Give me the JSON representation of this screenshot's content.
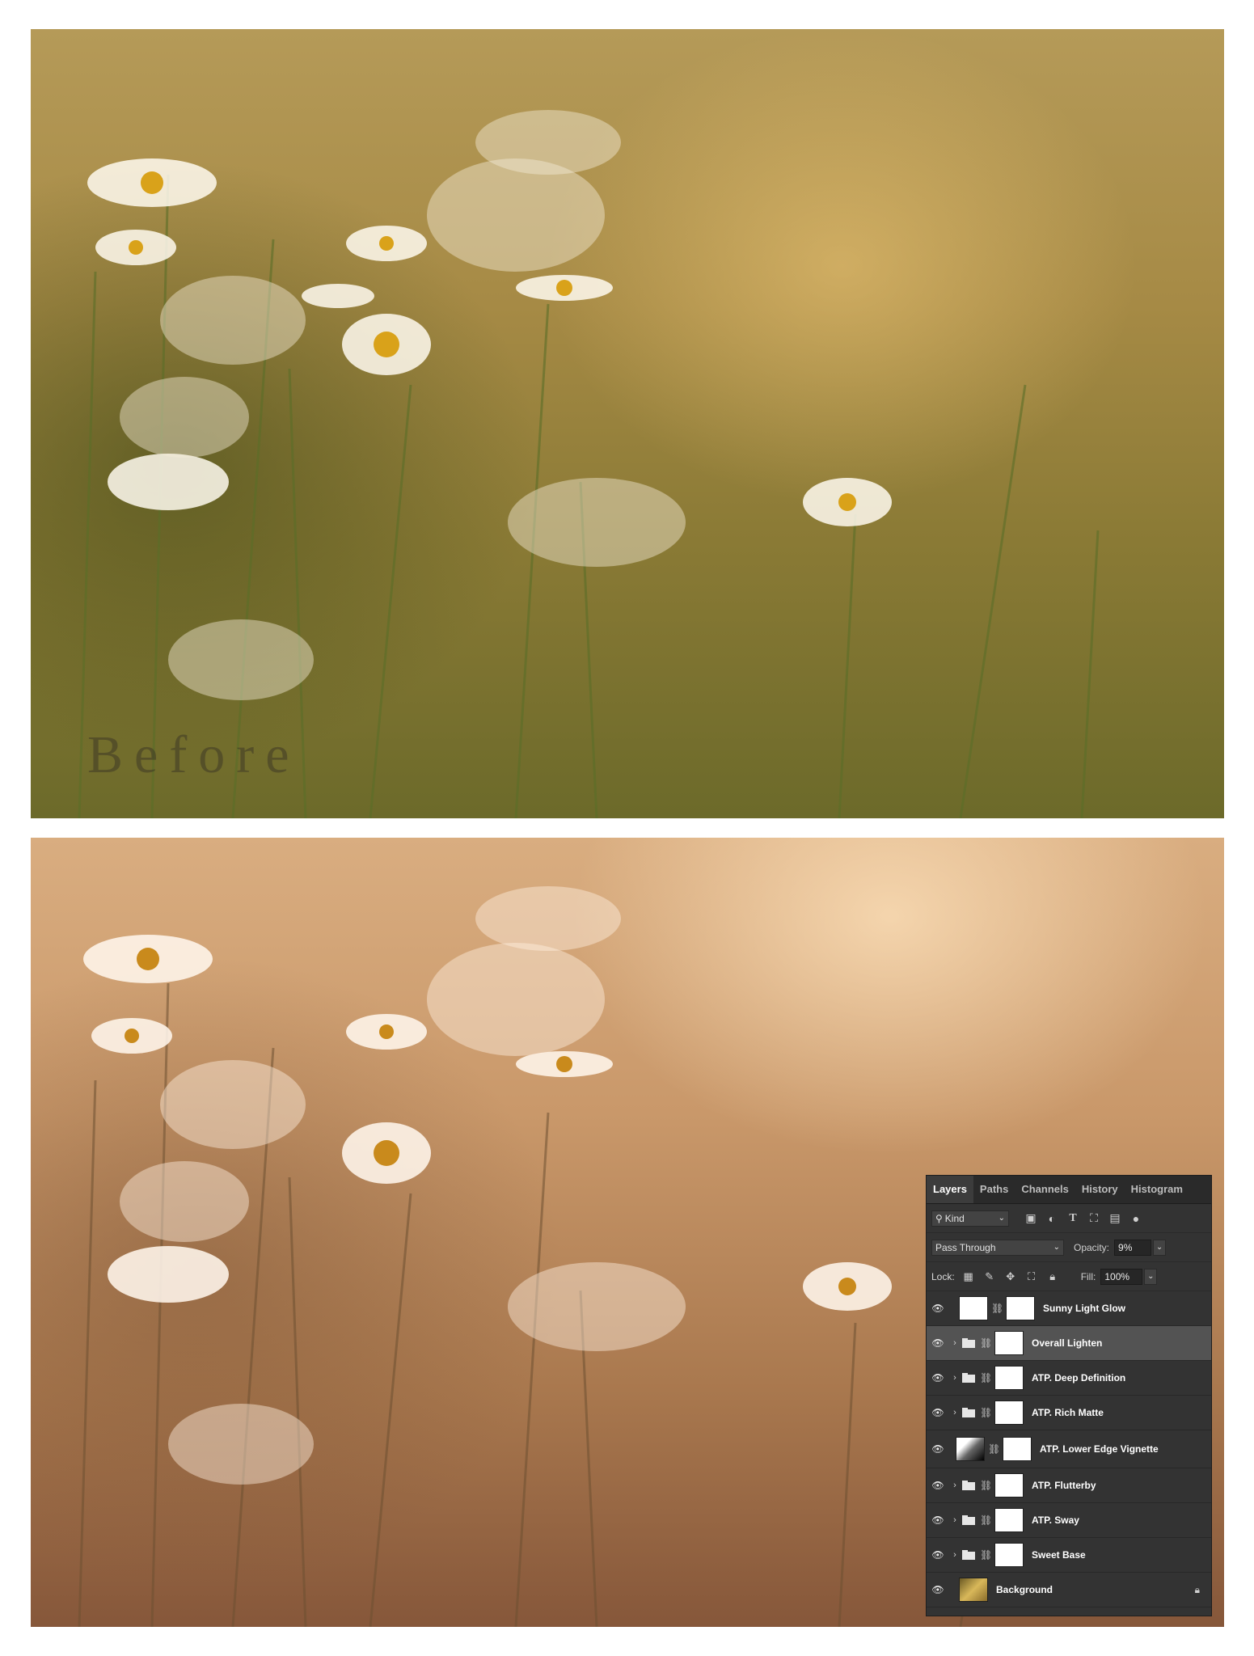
{
  "before_label": "Before",
  "layers_panel": {
    "tabs": [
      "Layers",
      "Paths",
      "Channels",
      "History",
      "Histogram"
    ],
    "active_tab": "Layers",
    "filter": {
      "kind_label": "Kind",
      "icons": [
        "image-filter-icon",
        "adjustment-filter-icon",
        "type-filter-icon",
        "shape-filter-icon",
        "smart-object-filter-icon",
        "filter-toggle-icon"
      ]
    },
    "blend_mode": "Pass Through",
    "opacity_label": "Opacity:",
    "opacity_value": "9%",
    "lock_label": "Lock:",
    "fill_label": "Fill:",
    "fill_value": "100%",
    "layers": [
      {
        "name": "Sunny Light Glow",
        "type": "adjustment",
        "selected": false
      },
      {
        "name": "Overall Lighten",
        "type": "group",
        "selected": true
      },
      {
        "name": "ATP. Deep Definition",
        "type": "group",
        "selected": false
      },
      {
        "name": "ATP. Rich Matte",
        "type": "group",
        "selected": false
      },
      {
        "name": "ATP. Lower Edge Vignette",
        "type": "gradient",
        "selected": false
      },
      {
        "name": "ATP. Flutterby",
        "type": "group",
        "selected": false
      },
      {
        "name": "ATP. Sway",
        "type": "group",
        "selected": false
      },
      {
        "name": "Sweet Base",
        "type": "group",
        "selected": false
      },
      {
        "name": "Background",
        "type": "background",
        "selected": false
      }
    ]
  }
}
